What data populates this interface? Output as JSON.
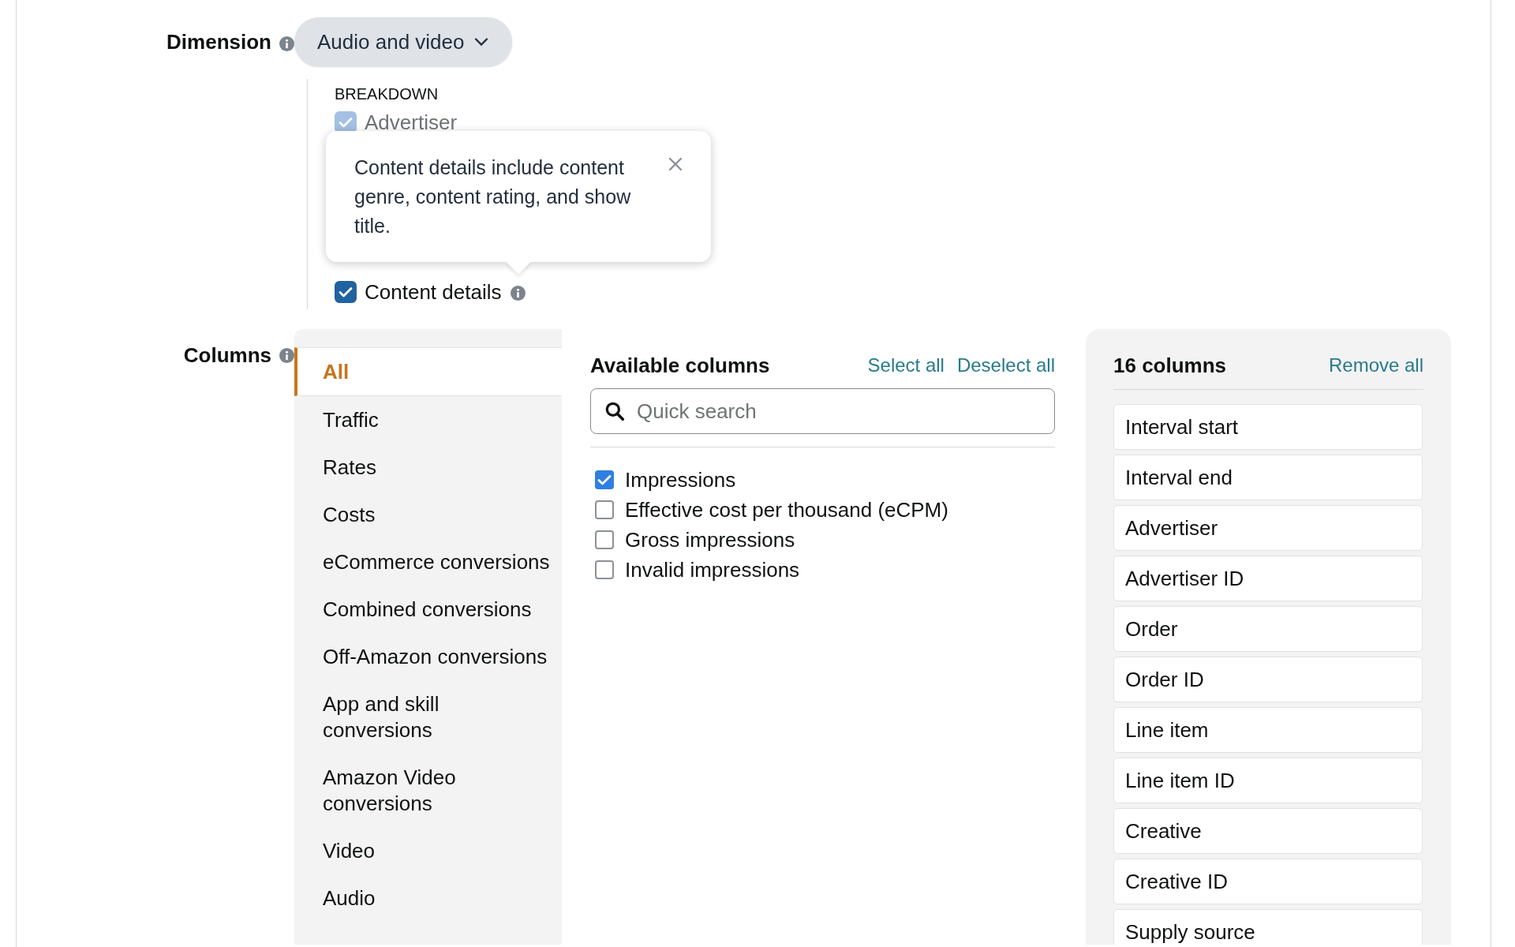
{
  "dimension": {
    "label": "Dimension",
    "value": "Audio and video"
  },
  "breakdown": {
    "heading": "BREAKDOWN",
    "items": [
      {
        "label": "Advertiser",
        "checked": true,
        "disabled": true,
        "info": false
      },
      {
        "label": "Content details",
        "checked": true,
        "disabled": false,
        "info": true
      }
    ]
  },
  "tooltip": {
    "text": "Content details include content genre, content rating, and show title."
  },
  "columns": {
    "label": "Columns",
    "categories": [
      {
        "label": "All",
        "selected": true
      },
      {
        "label": "Traffic",
        "selected": false
      },
      {
        "label": "Rates",
        "selected": false
      },
      {
        "label": "Costs",
        "selected": false
      },
      {
        "label": "eCommerce conversions",
        "selected": false
      },
      {
        "label": "Combined conversions",
        "selected": false
      },
      {
        "label": "Off-Amazon conversions",
        "selected": false
      },
      {
        "label": "App and skill conversions",
        "selected": false
      },
      {
        "label": "Amazon Video conversions",
        "selected": false
      },
      {
        "label": "Video",
        "selected": false
      },
      {
        "label": "Audio",
        "selected": false
      }
    ],
    "available": {
      "title": "Available columns",
      "select_all": "Select all",
      "deselect_all": "Deselect all",
      "search": {
        "placeholder": "Quick search"
      },
      "items": [
        {
          "label": "Impressions",
          "checked": true
        },
        {
          "label": "Effective cost per thousand (eCPM)",
          "checked": false
        },
        {
          "label": "Gross impressions",
          "checked": false
        },
        {
          "label": "Invalid impressions",
          "checked": false
        }
      ]
    },
    "chosen": {
      "title": "16 columns",
      "remove_all": "Remove all",
      "items": [
        "Interval start",
        "Interval end",
        "Advertiser",
        "Advertiser ID",
        "Order",
        "Order ID",
        "Line item",
        "Line item ID",
        "Creative",
        "Creative ID",
        "Supply source"
      ]
    }
  }
}
